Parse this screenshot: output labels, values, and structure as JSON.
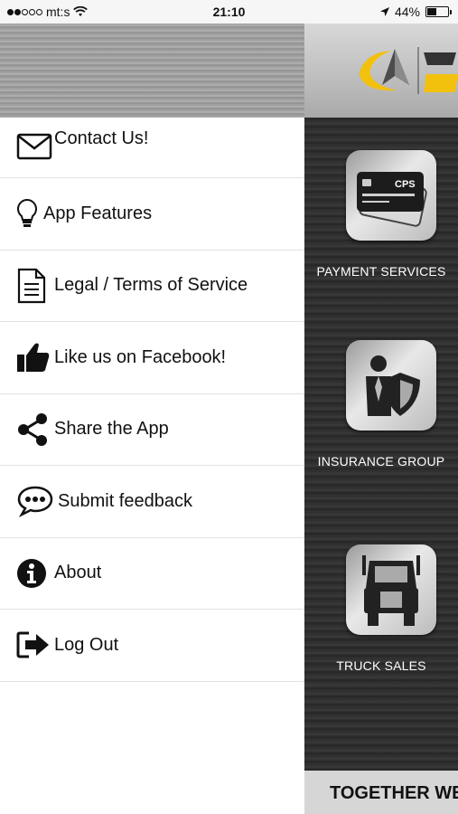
{
  "status_bar": {
    "carrier": "mt:s",
    "time": "21:10",
    "battery": "44%",
    "battery_level": 0.44,
    "signal_bars_filled": 2,
    "signal_bars_total": 5
  },
  "drawer": {
    "items": [
      {
        "label": "Contact Us!",
        "icon": "envelope-icon"
      },
      {
        "label": "App Features",
        "icon": "lightbulb-icon"
      },
      {
        "label": "Legal / Terms of Service",
        "icon": "document-icon"
      },
      {
        "label": "Like us on Facebook!",
        "icon": "thumbs-up-icon"
      },
      {
        "label": "Share the App",
        "icon": "share-icon"
      },
      {
        "label": "Submit feedback",
        "icon": "chat-bubble-icon"
      },
      {
        "label": "About",
        "icon": "info-icon"
      },
      {
        "label": "Log Out",
        "icon": "logout-icon"
      }
    ]
  },
  "background_app": {
    "services": [
      {
        "label": "PAYMENT SERVICES",
        "icon": "payment-card-icon"
      },
      {
        "label": "INSURANCE GROUP",
        "icon": "insurance-shield-icon"
      },
      {
        "label": "TRUCK SALES",
        "icon": "truck-icon"
      }
    ],
    "banner": "TOGETHER WE"
  },
  "colors": {
    "logo_yellow": "#f2c10e",
    "logo_gray": "#555555",
    "banner_bg": "#d6d6d6"
  }
}
